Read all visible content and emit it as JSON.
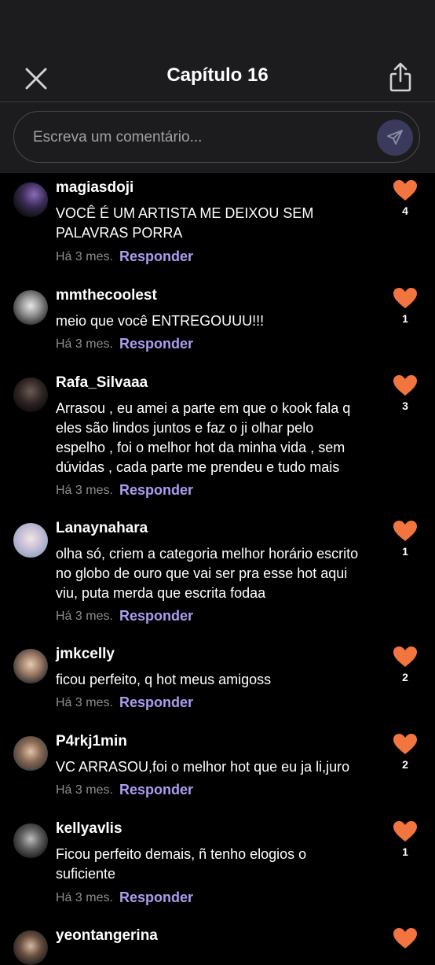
{
  "header": {
    "title": "Capítulo 16"
  },
  "comment_box": {
    "placeholder": "Escreva um comentário..."
  },
  "colors": {
    "accent": "#a99ef0",
    "heart": "#f2743f",
    "background": "#000000"
  },
  "comments": [
    {
      "user": "magiasdoji",
      "text": "VOCÊ É UM ARTISTA ME DEIXOU SEM PALAVRAS PORRA",
      "time": "Há 3 mes.",
      "reply": "Responder",
      "likes": "4"
    },
    {
      "user": "mmthecoolest",
      "text": "meio que você ENTREGOUUU!!!",
      "time": "Há 3 mes.",
      "reply": "Responder",
      "likes": "1"
    },
    {
      "user": "Rafa_Silvaaa",
      "text": "Arrasou , eu amei a parte em que o kook fala q eles são lindos juntos e faz o ji olhar pelo espelho , foi o melhor hot da minha vida , sem dúvidas , cada parte me prendeu e tudo mais",
      "time": "Há 3 mes.",
      "reply": "Responder",
      "likes": "3"
    },
    {
      "user": "Lanaynahara",
      "text": "olha só, criem a categoria melhor horário escrito no globo de ouro que vai ser pra esse hot aqui viu, puta merda que escrita fodaa",
      "time": "Há 3 mes.",
      "reply": "Responder",
      "likes": "1"
    },
    {
      "user": "jmkcelly",
      "text": "ficou perfeito, q hot meus amigoss",
      "time": "Há 3 mes.",
      "reply": "Responder",
      "likes": "2"
    },
    {
      "user": "P4rkj1min",
      "text": "VC ARRASOU,foi o melhor hot que eu ja li,juro",
      "time": "Há 3 mes.",
      "reply": "Responder",
      "likes": "2"
    },
    {
      "user": "kellyavlis",
      "text": "Ficou perfeito demais, ñ tenho elogios o suficiente",
      "time": "Há 3 mes.",
      "reply": "Responder",
      "likes": "1"
    },
    {
      "user": "yeontangerina",
      "text": "",
      "time": "",
      "reply": "",
      "likes": ""
    }
  ]
}
